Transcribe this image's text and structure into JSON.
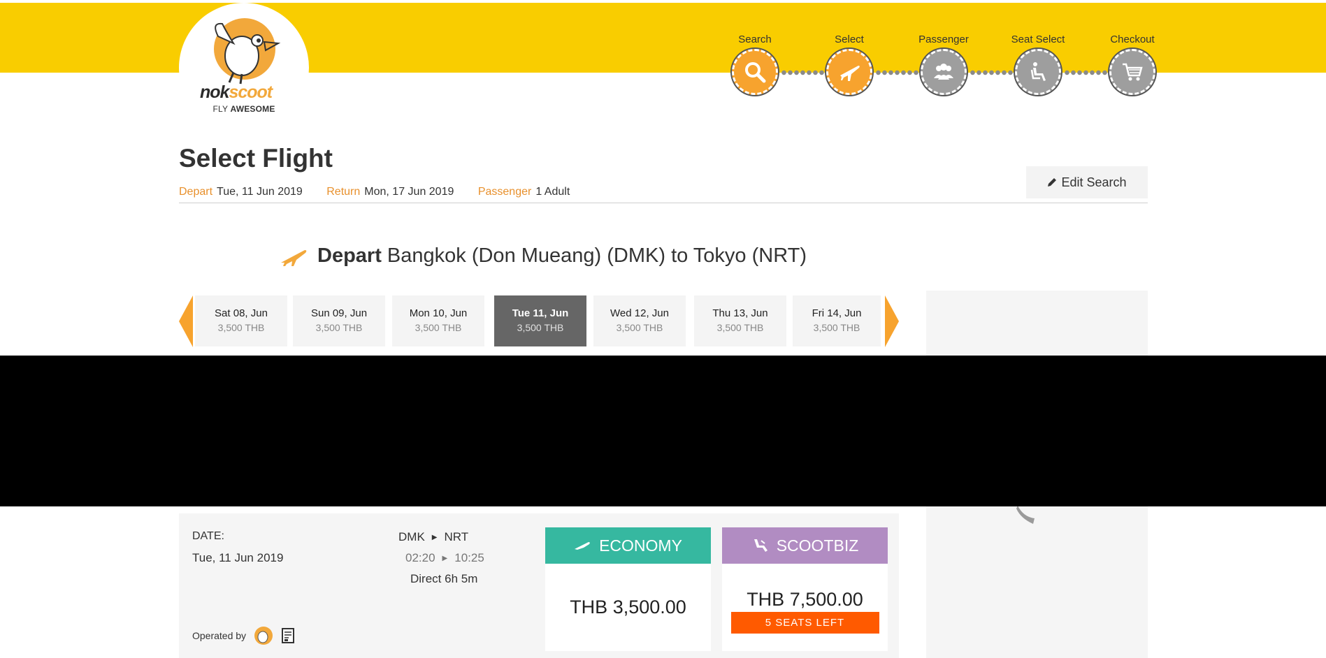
{
  "brand": {
    "logo_primary": "nok",
    "logo_secondary": "scoot",
    "tagline_prefix": "FLY ",
    "tagline_bold": "AWESOME",
    "colors": {
      "yellow": "#f9cd00",
      "orange": "#f7a32e",
      "economy": "#36b8a0",
      "scootbiz": "#b18cc2",
      "alert": "#ff5a00"
    }
  },
  "steps": [
    {
      "label": "Search",
      "icon": "search-icon",
      "state": "active"
    },
    {
      "label": "Select",
      "icon": "plane-icon",
      "state": "active"
    },
    {
      "label": "Passenger",
      "icon": "group-icon",
      "state": "inactive"
    },
    {
      "label": "Seat Select",
      "icon": "seat-icon",
      "state": "inactive"
    },
    {
      "label": "Checkout",
      "icon": "cart-icon",
      "state": "inactive"
    }
  ],
  "page": {
    "title": "Select Flight",
    "summary": {
      "depart_label": "Depart",
      "depart_value": "Tue, 11 Jun 2019",
      "return_label": "Return",
      "return_value": "Mon, 17 Jun 2019",
      "passenger_label": "Passenger",
      "passenger_value": "1 Adult"
    },
    "edit_search": "Edit Search"
  },
  "route": {
    "label": "Depart",
    "description": "Bangkok (Don Mueang) (DMK) to Tokyo (NRT)"
  },
  "dates": [
    {
      "date": "Sat 08, Jun",
      "price": "3,500 THB",
      "selected": false
    },
    {
      "date": "Sun 09, Jun",
      "price": "3,500 THB",
      "selected": false
    },
    {
      "date": "Mon 10, Jun",
      "price": "3,500 THB",
      "selected": false
    },
    {
      "date": "Tue 11, Jun",
      "price": "3,500 THB",
      "selected": true
    },
    {
      "date": "Wed 12, Jun",
      "price": "3,500 THB",
      "selected": false
    },
    {
      "date": "Thu 13, Jun",
      "price": "3,500 THB",
      "selected": false
    },
    {
      "date": "Fri 14, Jun",
      "price": "3,500 THB",
      "selected": false
    }
  ],
  "flight": {
    "date_label": "DATE:",
    "date_value": "Tue, 11 Jun 2019",
    "origin": "DMK",
    "destination": "NRT",
    "depart_time": "02:20",
    "arrive_time": "10:25",
    "duration": "Direct 6h 5m",
    "operated_by": "Operated by",
    "fares": {
      "economy": {
        "name": "ECONOMY",
        "price": "THB 3,500.00"
      },
      "scootbiz": {
        "name": "SCOOTBIZ",
        "price": "THB 7,500.00",
        "seats_left": "5 SEATS LEFT"
      }
    }
  }
}
